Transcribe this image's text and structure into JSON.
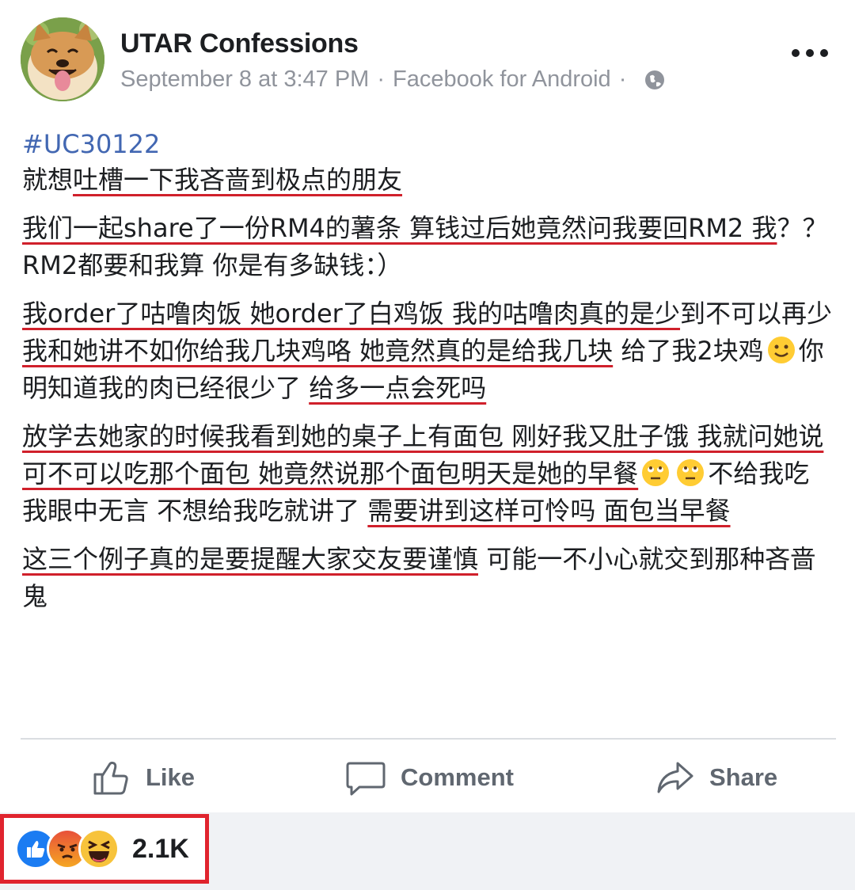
{
  "header": {
    "page_name": "UTAR Confessions",
    "timestamp": "September 8 at 3:47 PM",
    "separator": "·",
    "source": "Facebook for Android",
    "privacy_icon": "globe-icon",
    "more_icon": "more-options-icon"
  },
  "post": {
    "hashtag": "#UC30122",
    "p1": {
      "a": "就想",
      "b": "吐槽一下我吝啬到极点的朋友"
    },
    "p2": {
      "a": "我们一起share了一份RM4的薯条 算钱过后她竟然问我要回RM2 我",
      "b": "？？",
      "c": "RM2都要和我算 你是有多缺钱：）"
    },
    "p3": {
      "a": "我order了咕噜肉饭 她order了白鸡饭 我的咕噜肉真的是少",
      "b": "到不可以再少 ",
      "c": "我和她讲不如你给我几块鸡咯 她竟然真的是给我几块",
      "d": " 给了我2块鸡",
      "e": "你明知道我的肉已经很少了 ",
      "f": "给多一点会死吗"
    },
    "p4": {
      "a": "放学去她家的时候我看到她的桌子上有面包 刚好我又肚子饿 我就问她说可不可以吃那个面包 她竟然说那个面包明天是她的早餐",
      "b": "不给我吃 我眼中无言 不想给我吃就讲了 ",
      "c": "需要讲到这样可怜吗 面包当早餐"
    },
    "p5": {
      "a": "这三个例子真的是要提醒大家交友要谨慎",
      "b": " 可能一不小心就交到那种吝啬鬼"
    }
  },
  "actions": {
    "like_label": "Like",
    "comment_label": "Comment",
    "share_label": "Share"
  },
  "reactions": {
    "count": "2.1K",
    "types": [
      "like",
      "angry",
      "haha"
    ],
    "highlight_color": "#e0242e"
  },
  "colors": {
    "hashtag": "#4267b2",
    "underline": "#d0202b",
    "meta": "#90949c",
    "action_text": "#606770"
  }
}
